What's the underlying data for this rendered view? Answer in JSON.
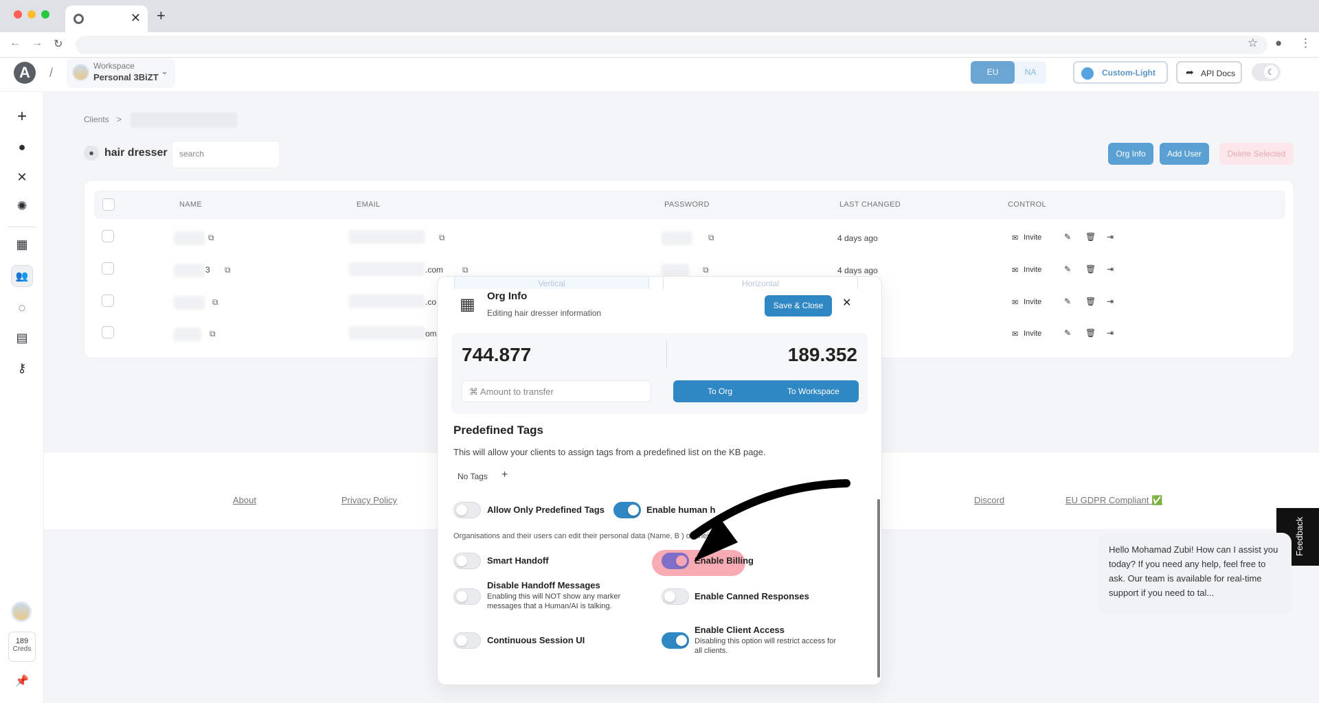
{
  "browser": {
    "traffic_colors": [
      "#ff5f57",
      "#febc2e",
      "#28c840"
    ],
    "tab_close": "✕",
    "new_tab": "+"
  },
  "header": {
    "logo": "A",
    "separator": "/",
    "workspace_label": "Workspace",
    "workspace_name": "Personal 3BiZT",
    "region_eu": "EU",
    "region_na": "NA",
    "theme_label": "Custom-Light",
    "api_docs_label": "API Docs"
  },
  "sidebar": {
    "icons": [
      "plus-icon",
      "chat-bubble-icon",
      "tools-icon",
      "bug-icon",
      "building-icon",
      "users-icon",
      "refresh-icon",
      "card-icon",
      "key-icon"
    ],
    "creds_count": "189",
    "creds_label": "Creds"
  },
  "page": {
    "breadcrumb_root": "Clients",
    "breadcrumb_sep": ">",
    "org_name": "hair dresser",
    "search_placeholder": "search",
    "org_info_button": "Org Info",
    "add_user_button": "Add User",
    "delete_selected_button": "Delete Selected"
  },
  "table": {
    "columns": [
      "NAME",
      "EMAIL",
      "PASSWORD",
      "LAST CHANGED",
      "CONTROL"
    ],
    "rows": [
      {
        "name_suffix": "",
        "email_suffix": "",
        "password": "",
        "last_changed": "4 days ago",
        "invite": "Invite"
      },
      {
        "name_suffix": "3",
        "email_suffix": ".com",
        "password": "",
        "last_changed": "4 days ago",
        "invite": "Invite"
      },
      {
        "name_suffix": "",
        "email_suffix": ".co",
        "password": "",
        "last_changed": "",
        "invite": "Invite"
      },
      {
        "name_suffix": "",
        "email_suffix": "om",
        "password": "",
        "last_changed": "",
        "invite": "Invite"
      }
    ]
  },
  "footer": {
    "links": [
      "About",
      "Privacy Policy",
      "Discord",
      "EU GDPR Compliant ✅"
    ]
  },
  "modal": {
    "seg_vertical": "Vertical",
    "seg_horizontal": "Horizontal",
    "title": "Org Info",
    "subtitle": "Editing hair dresser information",
    "save_close": "Save & Close",
    "close": "✕",
    "org_credits": "744.877",
    "workspace_credits": "189.352",
    "amount_placeholder": "Amount to transfer",
    "to_org": "To Org",
    "to_workspace": "To Workspace",
    "tags_title": "Predefined Tags",
    "tags_desc": "This will allow your clients to assign tags from a predefined list on the KB page.",
    "no_tags": "No Tags",
    "add_tag": "+",
    "allow_only_predefined": "Allow Only Predefined Tags",
    "enable_human_handoff": "Enable human h",
    "org_note": "Organisations and their users can edit their personal data (Name, B                ) on their own.",
    "smart_handoff": "Smart Handoff",
    "enable_billing": "Enable Billing",
    "disable_handoff_title": "Disable Handoff Messages",
    "disable_handoff_desc1": "Enabling this will NOT show any marker",
    "disable_handoff_desc2": "messages that a Human/AI is talking.",
    "enable_canned": "Enable Canned Responses",
    "continuous_session": "Continuous Session UI",
    "enable_client_access": "Enable Client Access",
    "client_access_desc1": "Disabling this option will restrict access for",
    "client_access_desc2": "all clients.",
    "toggles": {
      "allow_only_predefined": false,
      "enable_human_handoff": true,
      "smart_handoff": false,
      "enable_billing": true,
      "disable_handoff": false,
      "enable_canned": false,
      "continuous_session": false,
      "enable_client_access": true
    }
  },
  "feedback_label": "Feedback",
  "chat_message": "Hello Mohamad Zubi! How can I assist you today? If you need any help, feel free to ask. Our team is available for real-time support if you need to tal..."
}
